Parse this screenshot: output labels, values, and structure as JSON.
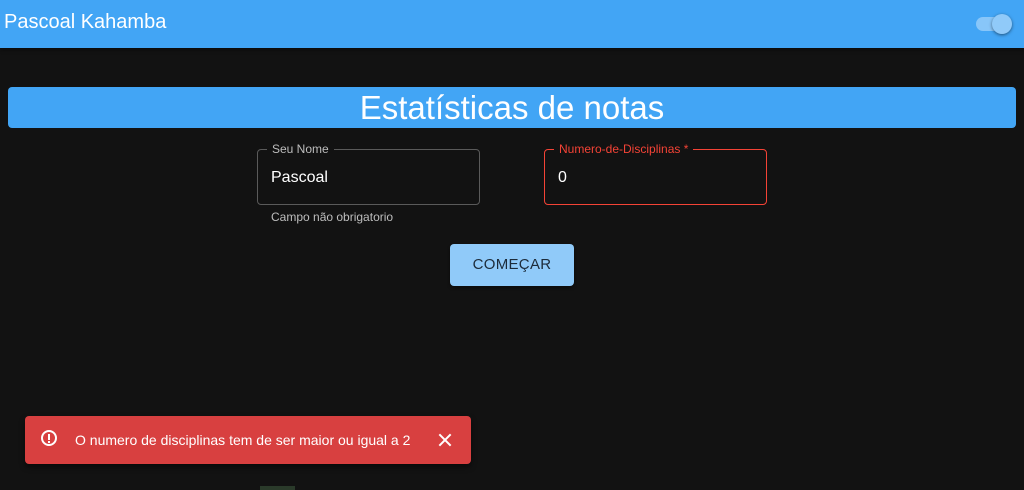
{
  "appbar": {
    "title": "Pascoal Kahamba",
    "theme_toggle_on": true
  },
  "main": {
    "heading": "Estatísticas de notas",
    "name_field": {
      "label": "Seu Nome",
      "value": "Pascoal",
      "helper": "Campo não obrigatorio"
    },
    "disciplines_field": {
      "label": "Numero-de-Disciplinas *",
      "value": "0",
      "error": true
    },
    "start_button": "COMEÇAR"
  },
  "snackbar": {
    "message": "O numero de disciplinas tem de ser maior ou igual a 2",
    "severity": "error",
    "icon": "error-outline-icon",
    "close_icon": "close-icon"
  },
  "colors": {
    "primary": "#42a5f5",
    "primary_light": "#90caf9",
    "background": "#121212",
    "error": "#f44336",
    "snackbar_bg": "#d84040"
  }
}
